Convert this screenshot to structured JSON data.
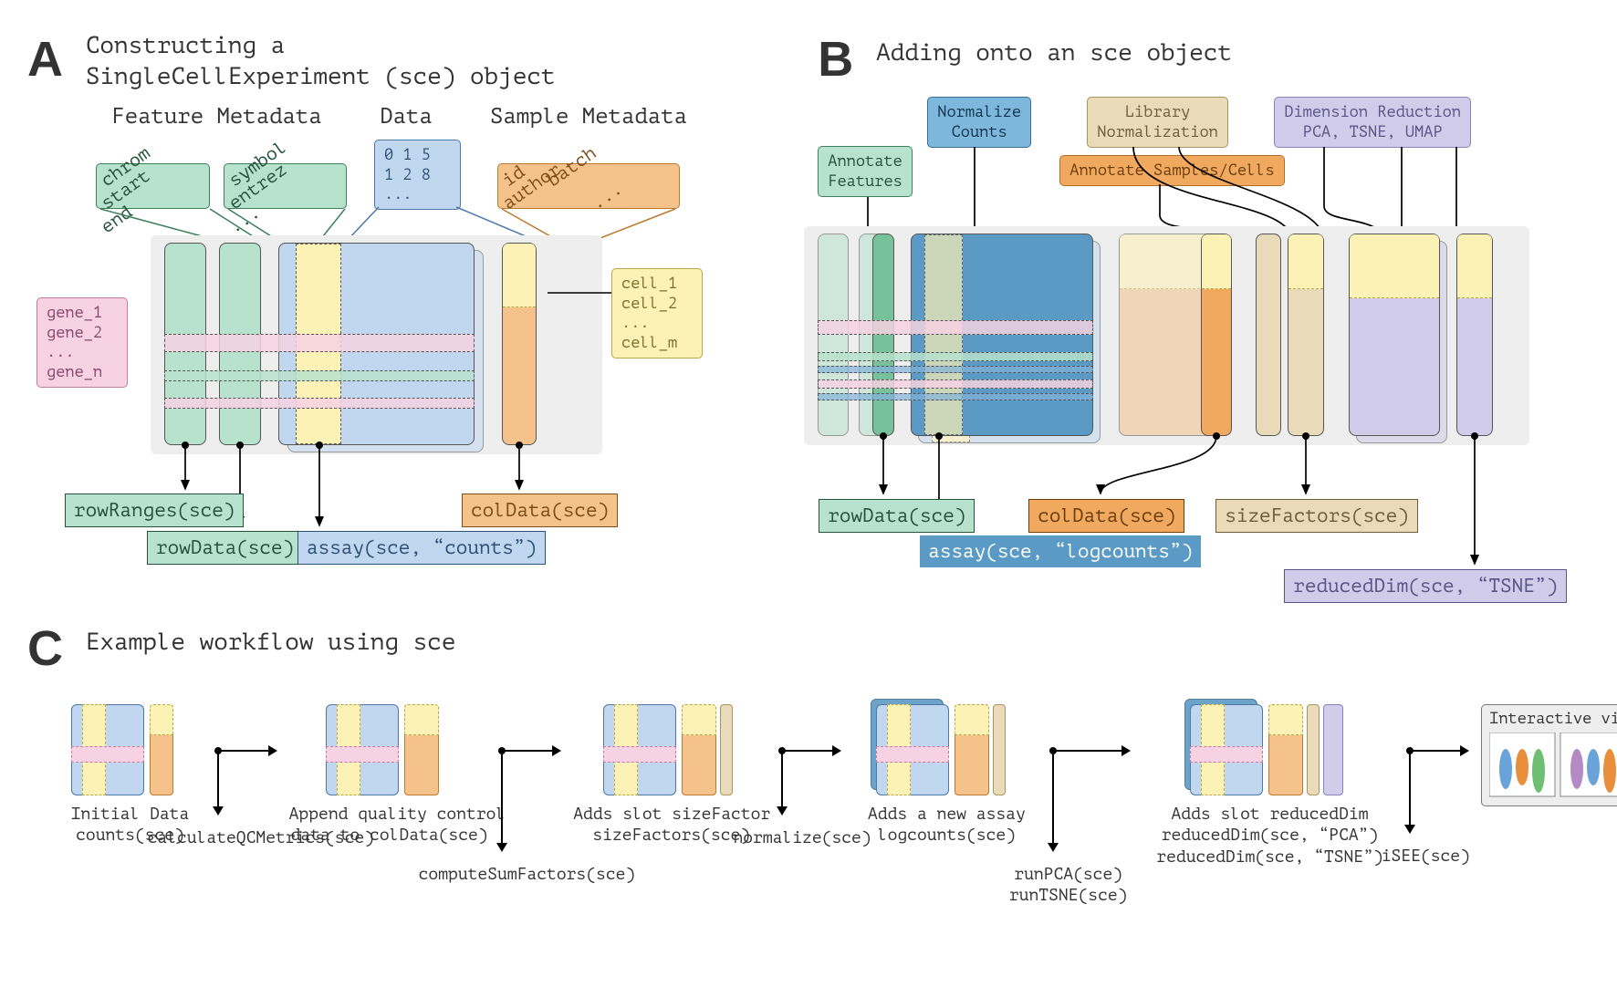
{
  "panels": {
    "A": {
      "letter": "A",
      "title_line1": "Constructing a",
      "title_line2": "SingleCellExperiment (sce) object",
      "headers": {
        "feature_meta": "Feature Metadata",
        "data": "Data",
        "sample_meta": "Sample Metadata"
      },
      "feature_tilt1": [
        "chrom",
        "start",
        "end"
      ],
      "feature_tilt2": [
        "symbol",
        "entrez",
        "..."
      ],
      "data_matrix": [
        "0 1 5",
        "1 2 8",
        "..."
      ],
      "sample_tilt": [
        "id",
        "batch",
        "author",
        "..."
      ],
      "genes": [
        "gene_1",
        "gene_2",
        "...",
        "gene_n"
      ],
      "cells": [
        "cell_1",
        "cell_2",
        "...",
        "cell_m"
      ],
      "accessors": {
        "rowRanges": "rowRanges(sce)",
        "rowData": "rowData(sce)",
        "assay": "assay(sce, “counts”)",
        "colData": "colData(sce)"
      }
    },
    "B": {
      "letter": "B",
      "title": "Adding onto an sce object",
      "badges": {
        "annotate_features": "Annotate\nFeatures",
        "normalize_counts": "Normalize\nCounts",
        "library_norm": "Library\nNormalization",
        "dimred": "Dimension Reduction\nPCA, TSNE, UMAP",
        "annotate_samples": "Annotate Samples/Cells"
      },
      "accessors": {
        "rowData": "rowData(sce)",
        "colData": "colData(sce)",
        "sizeFactors": "sizeFactors(sce)",
        "assay": "assay(sce, “logcounts”)",
        "reducedDim": "reducedDim(sce, “TSNE”)"
      }
    },
    "C": {
      "letter": "C",
      "title": "Example workflow using sce",
      "steps": [
        {
          "caption": "Initial Data\ncounts(sce)",
          "fn": "calculateQCMetrics(sce)"
        },
        {
          "caption": "Append quality control\ndata to colData(sce)",
          "fn": "computeSumFactors(sce)"
        },
        {
          "caption": "Adds slot sizeFactor\nsizeFactors(sce)",
          "fn": "normalize(sce)"
        },
        {
          "caption": "Adds a new assay\nlogcounts(sce)",
          "fn": "runPCA(sce)\nrunTSNE(sce)"
        },
        {
          "caption": "Adds slot reducedDim\nreducedDim(sce, “PCA”)\nreducedDim(sce, “TSNE”)",
          "fn": "iSEE(sce)"
        },
        {
          "caption": "Interactive visualization",
          "fn": ""
        }
      ]
    }
  }
}
